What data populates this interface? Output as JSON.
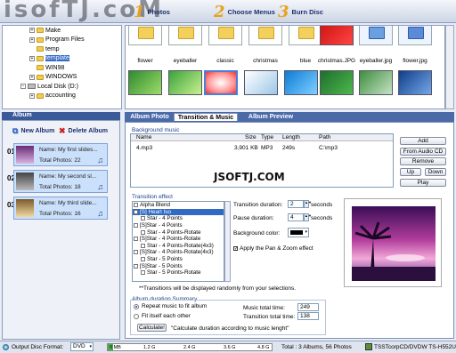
{
  "header": {
    "watermark": "isofTJ.coM",
    "steps": [
      {
        "num": "1",
        "label": "Photos"
      },
      {
        "num": "2",
        "label": "Choose Menus"
      },
      {
        "num": "3",
        "label": "Burn Disc"
      }
    ]
  },
  "tree": {
    "items": [
      {
        "label": "Make"
      },
      {
        "label": "Program Files"
      },
      {
        "label": "temp"
      },
      {
        "label": "template"
      },
      {
        "label": "WIN98"
      },
      {
        "label": "WINDOWS"
      },
      {
        "label": "Local Disk (D:)"
      },
      {
        "label": "accounting"
      }
    ]
  },
  "thumbs": {
    "labels": [
      "flower",
      "eyeballer",
      "classic",
      "christmas",
      "blue",
      "christmas.JPG",
      "eyeballer.jpg",
      "flower.jpg"
    ]
  },
  "album_panel": {
    "title": "Album",
    "new_album": "New Album",
    "delete_album": "Delete Album",
    "albums": [
      {
        "index": "01",
        "name": "Name: My first slides...",
        "total": "Total Photos: 22"
      },
      {
        "index": "02",
        "name": "Name: My second sl...",
        "total": "Total Photos: 18"
      },
      {
        "index": "03",
        "name": "Name: My third slide...",
        "total": "Total Photos: 16"
      }
    ]
  },
  "tabs": [
    "Album Photo",
    "Transition & Music",
    "Album Preview"
  ],
  "music": {
    "title": "Background music",
    "headers": {
      "name": "Name",
      "size": "Size",
      "type": "Type",
      "length": "Length",
      "path": "Path"
    },
    "row": {
      "name": "4.mp3",
      "size": "3,901 KB",
      "type": "MP3",
      "length": "249s",
      "path": "C:\\mp3"
    },
    "buttons": [
      "Add",
      "From Audio CD",
      "Remove",
      "Up",
      "Down",
      "Play"
    ],
    "watermark": "JSOFTJ.COM"
  },
  "transition": {
    "title": "Transition effect",
    "items": [
      "Alpha Blend",
      "[S] Heart Iso",
      "Star - 4 Points",
      "[S]Star - 4 Points",
      "Star - 4 Points-Rotate",
      "[S]Star - 4 Points-Rotate",
      "Star - 4 Points-Rotate(4x3)",
      "[S]Star - 4 Points-Rotate(4x3)",
      "Star - 5 Points",
      "[S]Star - 5 Points",
      "Star - 5 Points-Rotate"
    ],
    "note": "**Transitions will be displayed randomly from your selections.",
    "duration_label": "Transition duration:",
    "duration_value": "2",
    "pause_label": "Pause duration:",
    "pause_value": "4",
    "seconds": "seconds",
    "bg_color_label": "Background color:",
    "pan_zoom": "Apply the Pan & Zoom effect"
  },
  "summary": {
    "title": "Album duration Summary",
    "opt1": "Repeat music to fit album",
    "opt2": "Fit itself each other",
    "music_total_label": "Music total time:",
    "music_total": "249",
    "transition_total_label": "Transition total time:",
    "transition_total": "138",
    "calc_button": "Calculate!",
    "calc_note": "\"Calculate duration according to music lenght\""
  },
  "status": {
    "format_label": "Output Disc Format:",
    "format_value": "DVD",
    "scale": [
      "0 MB",
      "1.2 G",
      "2.4 G",
      "3.6 G",
      "4.8 G"
    ],
    "total": "Total : 3 Albums, 56 Photos",
    "drive": "TSSTcorpCD/DVDW TS-H552U"
  },
  "colors": {
    "accent": "#3b5a9a",
    "album_bg": "#cbe0fb",
    "selection": "#316ac5"
  }
}
